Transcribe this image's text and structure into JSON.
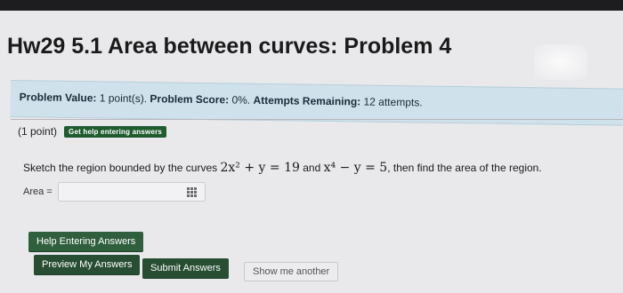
{
  "page": {
    "title": "Hw29 5.1 Area between curves: Problem 4"
  },
  "score_bar": {
    "problem_value_label": "Problem Value:",
    "problem_value": "1 point(s).",
    "problem_score_label": "Problem Score:",
    "problem_score": "0%.",
    "attempts_label": "Attempts Remaining:",
    "attempts": "12 attempts."
  },
  "problem": {
    "points": "(1 point)",
    "help_tag": "Get help entering answers",
    "question_prefix": "Sketch the region bounded by the curves",
    "curve1": "2x² + y = 19",
    "connector": "and",
    "curve2": "x⁴ − y = 5",
    "question_suffix": ", then find the area of the region.",
    "area_label": "Area =",
    "area_value": "",
    "keypad_icon": "keypad-icon"
  },
  "buttons": {
    "help": "Help Entering Answers",
    "preview": "Preview My Answers",
    "submit": "Submit Answers",
    "another": "Show me another"
  }
}
